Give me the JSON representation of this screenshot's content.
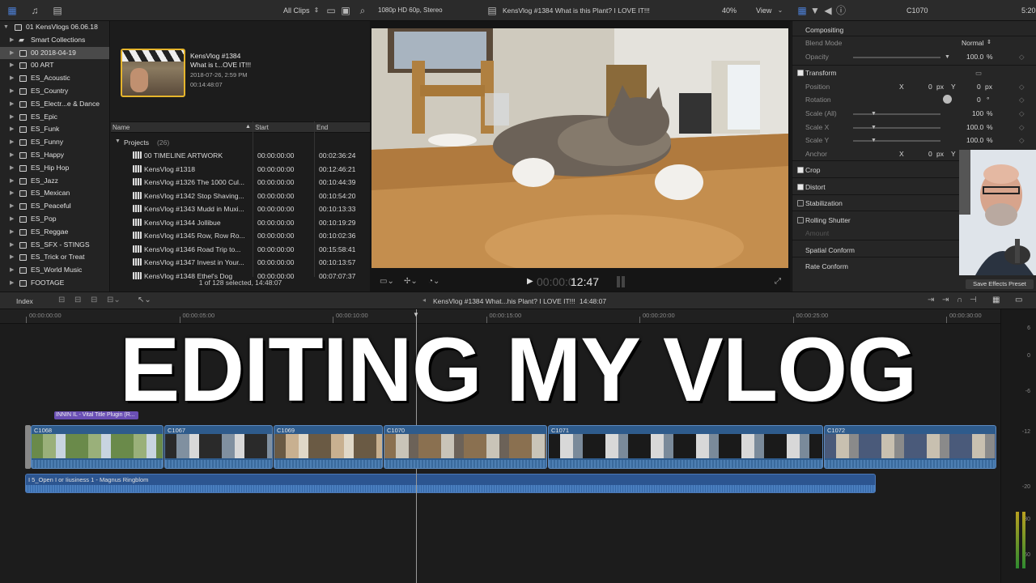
{
  "toolbar": {
    "clip_filter": "All Clips",
    "viewer_format": "1080p HD 60p, Stereo",
    "viewer_title": "KensVlog #1384 What is this Plant? I LOVE IT!!!",
    "zoom": "40%",
    "view_menu": "View",
    "inspector_clip": "C1070",
    "inspector_time": "5:20"
  },
  "libraries": {
    "library_name": "01 KensVlogs 06.06.18",
    "items": [
      {
        "label": "Smart Collections",
        "kind": "folder"
      },
      {
        "label": "00 2018-04-19",
        "kind": "event",
        "selected": true
      },
      {
        "label": "00 ART",
        "kind": "event"
      },
      {
        "label": "ES_Acoustic",
        "kind": "event"
      },
      {
        "label": "ES_Country",
        "kind": "event"
      },
      {
        "label": "ES_Electr...e & Dance",
        "kind": "event"
      },
      {
        "label": "ES_Epic",
        "kind": "event"
      },
      {
        "label": "ES_Funk",
        "kind": "event"
      },
      {
        "label": "ES_Funny",
        "kind": "event"
      },
      {
        "label": "ES_Happy",
        "kind": "event"
      },
      {
        "label": "ES_Hip Hop",
        "kind": "event"
      },
      {
        "label": "ES_Jazz",
        "kind": "event"
      },
      {
        "label": "ES_Mexican",
        "kind": "event"
      },
      {
        "label": "ES_Peaceful",
        "kind": "event"
      },
      {
        "label": "ES_Pop",
        "kind": "event"
      },
      {
        "label": "ES_Reggae",
        "kind": "event"
      },
      {
        "label": "ES_SFX - STINGS",
        "kind": "event"
      },
      {
        "label": "ES_Trick or Treat",
        "kind": "event"
      },
      {
        "label": "ES_World Music",
        "kind": "event"
      },
      {
        "label": "FOOTAGE",
        "kind": "event"
      }
    ]
  },
  "browser": {
    "clip": {
      "title": "KensVlog #1384",
      "subtitle": "What is t...OVE IT!!!",
      "date": "2018-07-26, 2:59 PM",
      "duration": "00:14:48:07"
    },
    "columns": {
      "name": "Name",
      "start": "Start",
      "end": "End"
    },
    "group_label": "Projects",
    "group_count": "(26)",
    "rows": [
      {
        "name": "00 TIMELINE ARTWORK",
        "start": "00:00:00:00",
        "end": "00:02:36:24"
      },
      {
        "name": "KensVlog #1318",
        "start": "00:00:00:00",
        "end": "00:12:46:21"
      },
      {
        "name": "KensVlog #1326 The 1000 Cul...",
        "start": "00:00:00:00",
        "end": "00:10:44:39"
      },
      {
        "name": "KensVlog #1342 Stop Shaving...",
        "start": "00:00:00:00",
        "end": "00:10:54:20"
      },
      {
        "name": "KensVlog #1343 Mudd in Muxi...",
        "start": "00:00:00:00",
        "end": "00:10:13:33"
      },
      {
        "name": "KensVlog #1344 Jollibue",
        "start": "00:00:00:00",
        "end": "00:10:19:29"
      },
      {
        "name": "KensVlog #1345 Row, Row Ro...",
        "start": "00:00:00:00",
        "end": "00:10:02:36"
      },
      {
        "name": "KensVlog #1346 Road Trip to...",
        "start": "00:00:00:00",
        "end": "00:15:58:41"
      },
      {
        "name": "KensVlog #1347 Invest in Your...",
        "start": "00:00:00:00",
        "end": "00:10:13:57"
      },
      {
        "name": "KensVlog #1348 Ethel's Dog",
        "start": "00:00:00:00",
        "end": "00:07:07:37"
      }
    ],
    "status": "1 of 128 selected, 14:48:07"
  },
  "viewer": {
    "timecode_dim": "00:00:0",
    "timecode": "12:47"
  },
  "inspector": {
    "compositing_title": "Compositing",
    "blend_mode_label": "Blend Mode",
    "blend_mode_value": "Normal",
    "opacity_label": "Opacity",
    "opacity_value": "100.0",
    "opacity_unit": "%",
    "transform_title": "Transform",
    "position_label": "Position",
    "position_x": "0",
    "position_y": "0",
    "px_unit": "px",
    "x_label": "X",
    "y_label": "Y",
    "rotation_label": "Rotation",
    "rotation_value": "0",
    "rotation_unit": "°",
    "scale_all_label": "Scale (All)",
    "scale_all_value": "100",
    "scale_x_label": "Scale X",
    "scale_x_value": "100.0",
    "scale_y_label": "Scale Y",
    "scale_y_value": "100.0",
    "anchor_label": "Anchor",
    "anchor_x": "0",
    "crop_label": "Crop",
    "distort_label": "Distort",
    "stabilization_label": "Stabilization",
    "rolling_shutter_label": "Rolling Shutter",
    "amount_label": "Amount",
    "spatial_conform_label": "Spatial Conform",
    "rate_conform_label": "Rate Conform",
    "save_preset_label": "Save Effects Preset"
  },
  "timeline_bar": {
    "index_label": "Index",
    "project_title": "KensVlog #1384 What...his Plant? I LOVE IT!!!",
    "duration": "14:48:07"
  },
  "timeline": {
    "ruler_ticks": [
      "00:00:00:00",
      "00:00:05:00",
      "00:00:10:00",
      "00:00:15:00",
      "00:00:20:00",
      "00:00:25:00",
      "00:00:30:00"
    ],
    "title_clip_label": "INNIN IL - Vital Title Plugin (R...",
    "clips": [
      {
        "name": "C1068"
      },
      {
        "name": "C1067"
      },
      {
        "name": "C1069"
      },
      {
        "name": "C1070"
      },
      {
        "name": "C1071"
      },
      {
        "name": "C1072"
      }
    ],
    "audio_clip_label": "I 5_Open I or Iiusiness 1 - Magnus Ringblom",
    "meter_labels": [
      "6",
      "0",
      "-6",
      "-12",
      "-20",
      "-30",
      "-50"
    ]
  },
  "overlay_title": "EDITING MY VLOG",
  "colors": {
    "accent_blue": "#2e5b8c",
    "title_purple": "#6a4fb4",
    "selection_yellow": "#e6b52c"
  }
}
